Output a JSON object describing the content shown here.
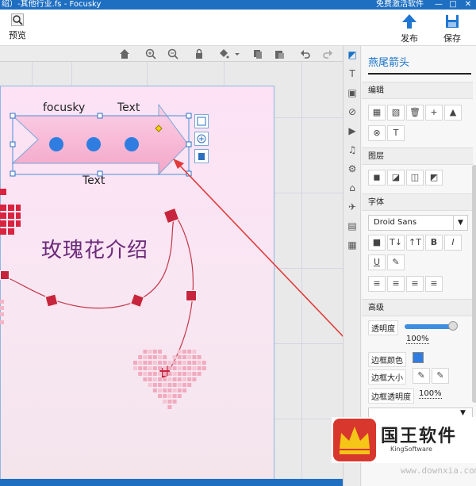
{
  "window": {
    "title": "绍）-其他行业.fs - Focusky",
    "activate_label": "免费激活软件",
    "controls": [
      "—",
      "□",
      "✕"
    ]
  },
  "toolbar": {
    "preview_label": "预览",
    "publish_label": "发布",
    "save_label": "保存"
  },
  "canvas": {
    "arrow_top_left_text": "focusky",
    "arrow_top_right_text": "Text",
    "arrow_bottom_text": "Text",
    "slide_title": "玫瑰花介绍"
  },
  "panel": {
    "shape_title": "燕尾箭头",
    "section_edit": "编辑",
    "section_layer": "图层",
    "section_font": "字体",
    "font_name": "Droid Sans",
    "section_advanced": "高级",
    "opacity_label": "透明度",
    "opacity_value": "100%",
    "opacity_fraction": 1.0,
    "border_color_label": "边框颜色",
    "border_size_label": "边框大小",
    "border_opacity_label": "边框透明度",
    "border_opacity_value": "100%"
  },
  "logo": {
    "name": "国王软件",
    "sub": "KingSoftware",
    "watermark": "www.downxia.com"
  },
  "colors": {
    "accent": "#1e6fc2",
    "arrow_red": "#e23b3b",
    "title_purple": "#6b2a7a",
    "dot_blue": "#2f7de1"
  }
}
